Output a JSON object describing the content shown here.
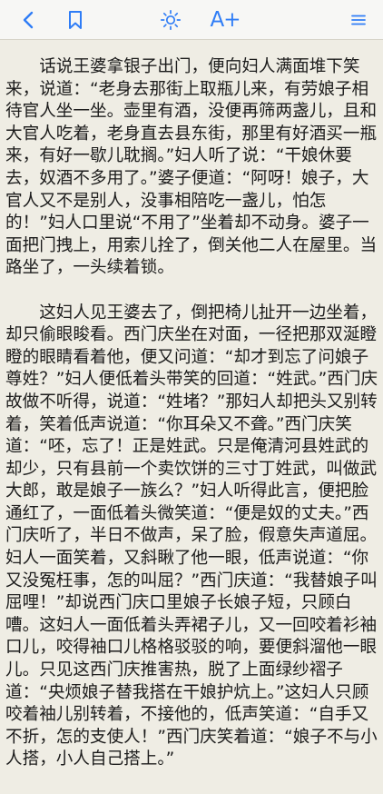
{
  "toolbar": {
    "back_icon": "chevron-left-icon",
    "bookmark_icon": "bookmark-icon",
    "brightness_icon": "sun-icon",
    "font_size_label": "A+",
    "menu_icon": "menu-icon",
    "accent_color": "#2f7df6"
  },
  "page": {
    "background_color": "#efede4",
    "text_color": "#1c1c1c"
  },
  "content": {
    "paragraphs": [
      "话说王婆拿银子出门，便向妇人满面堆下笑来，说道：“老身去那街上取瓶儿来，有劳娘子相待官人坐一坐。壶里有酒，没便再筛两盏儿，且和大官人吃着，老身直去县东街，那里有好酒买一瓶来，有好一歇儿耽搁。”妇人听了说：“干娘休要去，奴酒不多用了。”婆子便道：“阿呀！娘子，大官人又不是别人，没事相陪吃一盏儿，怕怎的！”妇人口里说“不用了”坐着却不动身。婆子一面把门拽上，用索儿拴了，倒关他二人在屋里。当路坐了，一头续着锁。",
      "这妇人见王婆去了，倒把椅儿扯开一边坐着，却只偷眼睃看。西门庆坐在对面，一径把那双涎瞪瞪的眼睛看着他，便又问道：“却才到忘了问娘子尊姓？”妇人便低着头带笑的回道：“姓武。”西门庆故做不听得，说道：“姓堵？”那妇人却把头又别转着，笑着低声说道：“你耳朵又不聋。”西门庆笑道：“呸，忘了！正是姓武。只是俺清河县姓武的却少，只有县前一个卖饮饼的三寸丁姓武，叫做武大郎，敢是娘子一族么？”妇人听得此言，便把脸通红了，一面低着头微笑道：“便是奴的丈夫。”西门庆听了，半日不做声，呆了脸，假意失声道屈。妇人一面笑着，又斜瞅了他一眼，低声说道：“你又没冤枉事，怎的叫屈？”西门庆道：“我替娘子叫屈哩！”却说西门庆口里娘子长娘子短，只顾白嘈。这妇人一面低着头弄裙子儿，又一回咬着衫袖口儿，咬得袖口儿格格驳驳的响，要便斜溜他一眼儿。只见这西门庆推害热，脱了上面绿纱褶子道：“央烦娘子替我搭在干娘护炕上。”这妇人只顾咬着袖儿别转着，不接他的，低声笑道：“自手又不折，怎的支使人！”西门庆笑着道：“娘子不与小人搭，小人自己搭上。”"
    ]
  }
}
